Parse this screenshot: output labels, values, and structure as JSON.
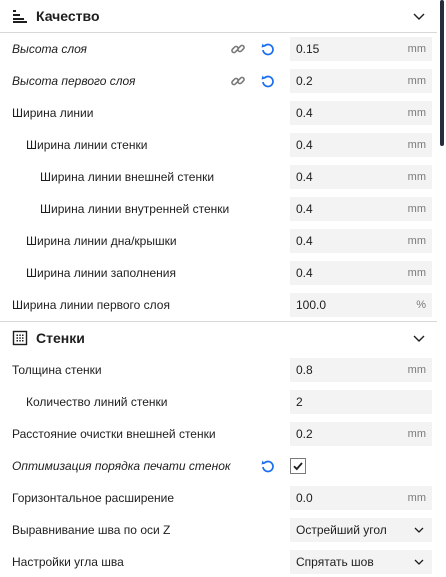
{
  "colors": {
    "accent": "#196ef0",
    "field_bg": "#f3f3f3",
    "text": "#1e1e1e",
    "unit": "#7a7a7a",
    "scroll_thumb": "#282b3c"
  },
  "quality": {
    "title": "Качество",
    "rows": [
      {
        "label": "Высота слоя",
        "value": "0.15",
        "unit": "mm"
      },
      {
        "label": "Высота первого слоя",
        "value": "0.2",
        "unit": "mm"
      },
      {
        "label": "Ширина линии",
        "value": "0.4",
        "unit": "mm"
      },
      {
        "label": "Ширина линии стенки",
        "value": "0.4",
        "unit": "mm"
      },
      {
        "label": "Ширина линии внешней стенки",
        "value": "0.4",
        "unit": "mm"
      },
      {
        "label": "Ширина линии внутренней стенки",
        "value": "0.4",
        "unit": "mm"
      },
      {
        "label": "Ширина линии дна/крышки",
        "value": "0.4",
        "unit": "mm"
      },
      {
        "label": "Ширина линии заполнения",
        "value": "0.4",
        "unit": "mm"
      },
      {
        "label": "Ширина линии первого слоя",
        "value": "100.0",
        "unit": "%"
      }
    ]
  },
  "walls": {
    "title": "Стенки",
    "rows": [
      {
        "label": "Толщина стенки",
        "value": "0.8",
        "unit": "mm"
      },
      {
        "label": "Количество линий стенки",
        "value": "2",
        "unit": ""
      },
      {
        "label": "Расстояние очистки внешней стенки",
        "value": "0.2",
        "unit": "mm"
      },
      {
        "label": "Оптимизация порядка печати стенок",
        "checked": true
      },
      {
        "label": "Горизонтальное расширение",
        "value": "0.0",
        "unit": "mm"
      },
      {
        "label": "Выравнивание шва по оси Z",
        "value": "Острейший угол"
      },
      {
        "label": "Настройки угла шва",
        "value": "Спрятать шов"
      }
    ]
  }
}
